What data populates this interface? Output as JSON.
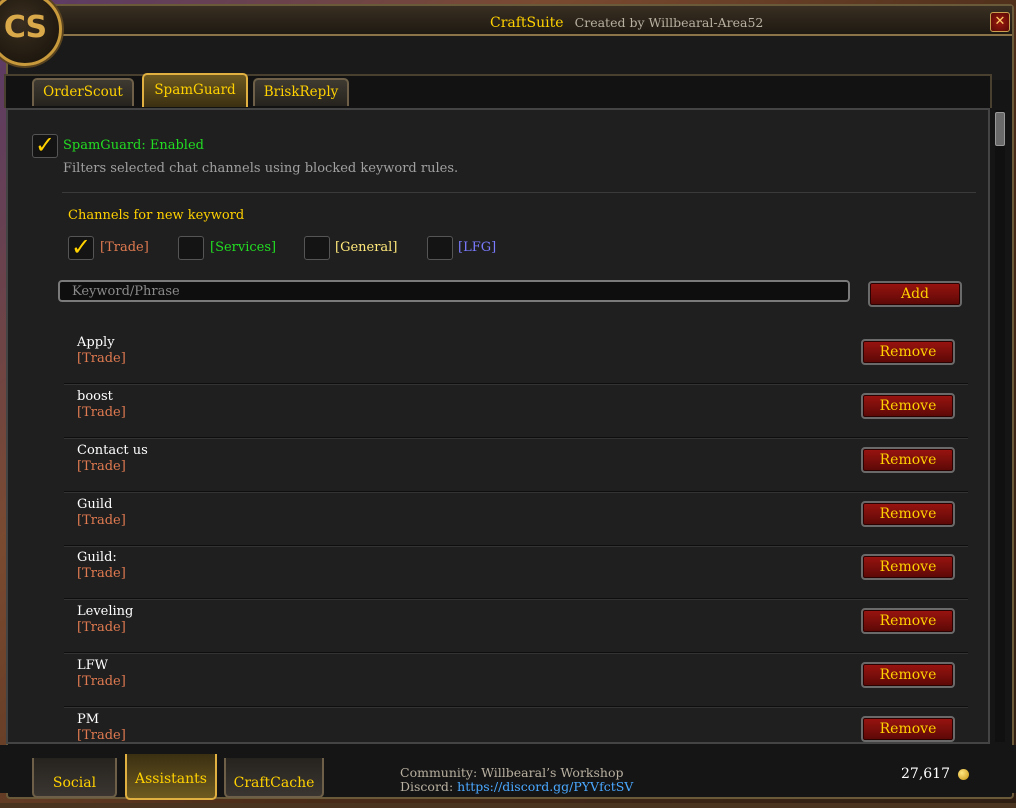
{
  "window": {
    "title": "CraftSuite",
    "subtitle": "Created by Willbearal-Area52",
    "logo_text": "CS",
    "close_glyph": "✕"
  },
  "tabs": [
    {
      "label": "OrderScout",
      "active": false
    },
    {
      "label": "SpamGuard",
      "active": true
    },
    {
      "label": "BriskReply",
      "active": false
    }
  ],
  "spamguard": {
    "enabled_label": "SpamGuard: Enabled",
    "enabled": true,
    "description": "Filters selected chat channels using blocked keyword rules.",
    "channels_heading": "Channels for new keyword",
    "channels": [
      {
        "label": "[Trade]",
        "checked": true,
        "color": "#e07a50"
      },
      {
        "label": "[Services]",
        "checked": false,
        "color": "#22dd22"
      },
      {
        "label": "[General]",
        "checked": false,
        "color": "#ffe87a"
      },
      {
        "label": "[LFG]",
        "checked": false,
        "color": "#7a7aff"
      }
    ],
    "keyword_placeholder": "Keyword/Phrase",
    "keyword_value": "",
    "add_label": "Add",
    "remove_label": "Remove",
    "rules": [
      {
        "keyword": "Apply",
        "channels": "[Trade]"
      },
      {
        "keyword": "boost",
        "channels": "[Trade]"
      },
      {
        "keyword": "Contact us",
        "channels": "[Trade]"
      },
      {
        "keyword": "Guild",
        "channels": "[Trade]"
      },
      {
        "keyword": "Guild:",
        "channels": "[Trade]"
      },
      {
        "keyword": "Leveling",
        "channels": "[Trade]"
      },
      {
        "keyword": "LFW",
        "channels": "[Trade]"
      },
      {
        "keyword": "PM",
        "channels": "[Trade]"
      }
    ]
  },
  "bottom_tabs": [
    {
      "label": "Social",
      "active": false
    },
    {
      "label": "Assistants",
      "active": true
    },
    {
      "label": "CraftCache",
      "active": false
    }
  ],
  "footer": {
    "community_label": "Community: Willbearal’s Workshop",
    "discord_label": "Discord:",
    "discord_link": "https://discord.gg/PYVfctSV",
    "gold": "27,617"
  },
  "colors": {
    "accent_gold": "#ffd100",
    "enabled_green": "#22dd22",
    "remove_red": "#9a1410"
  }
}
